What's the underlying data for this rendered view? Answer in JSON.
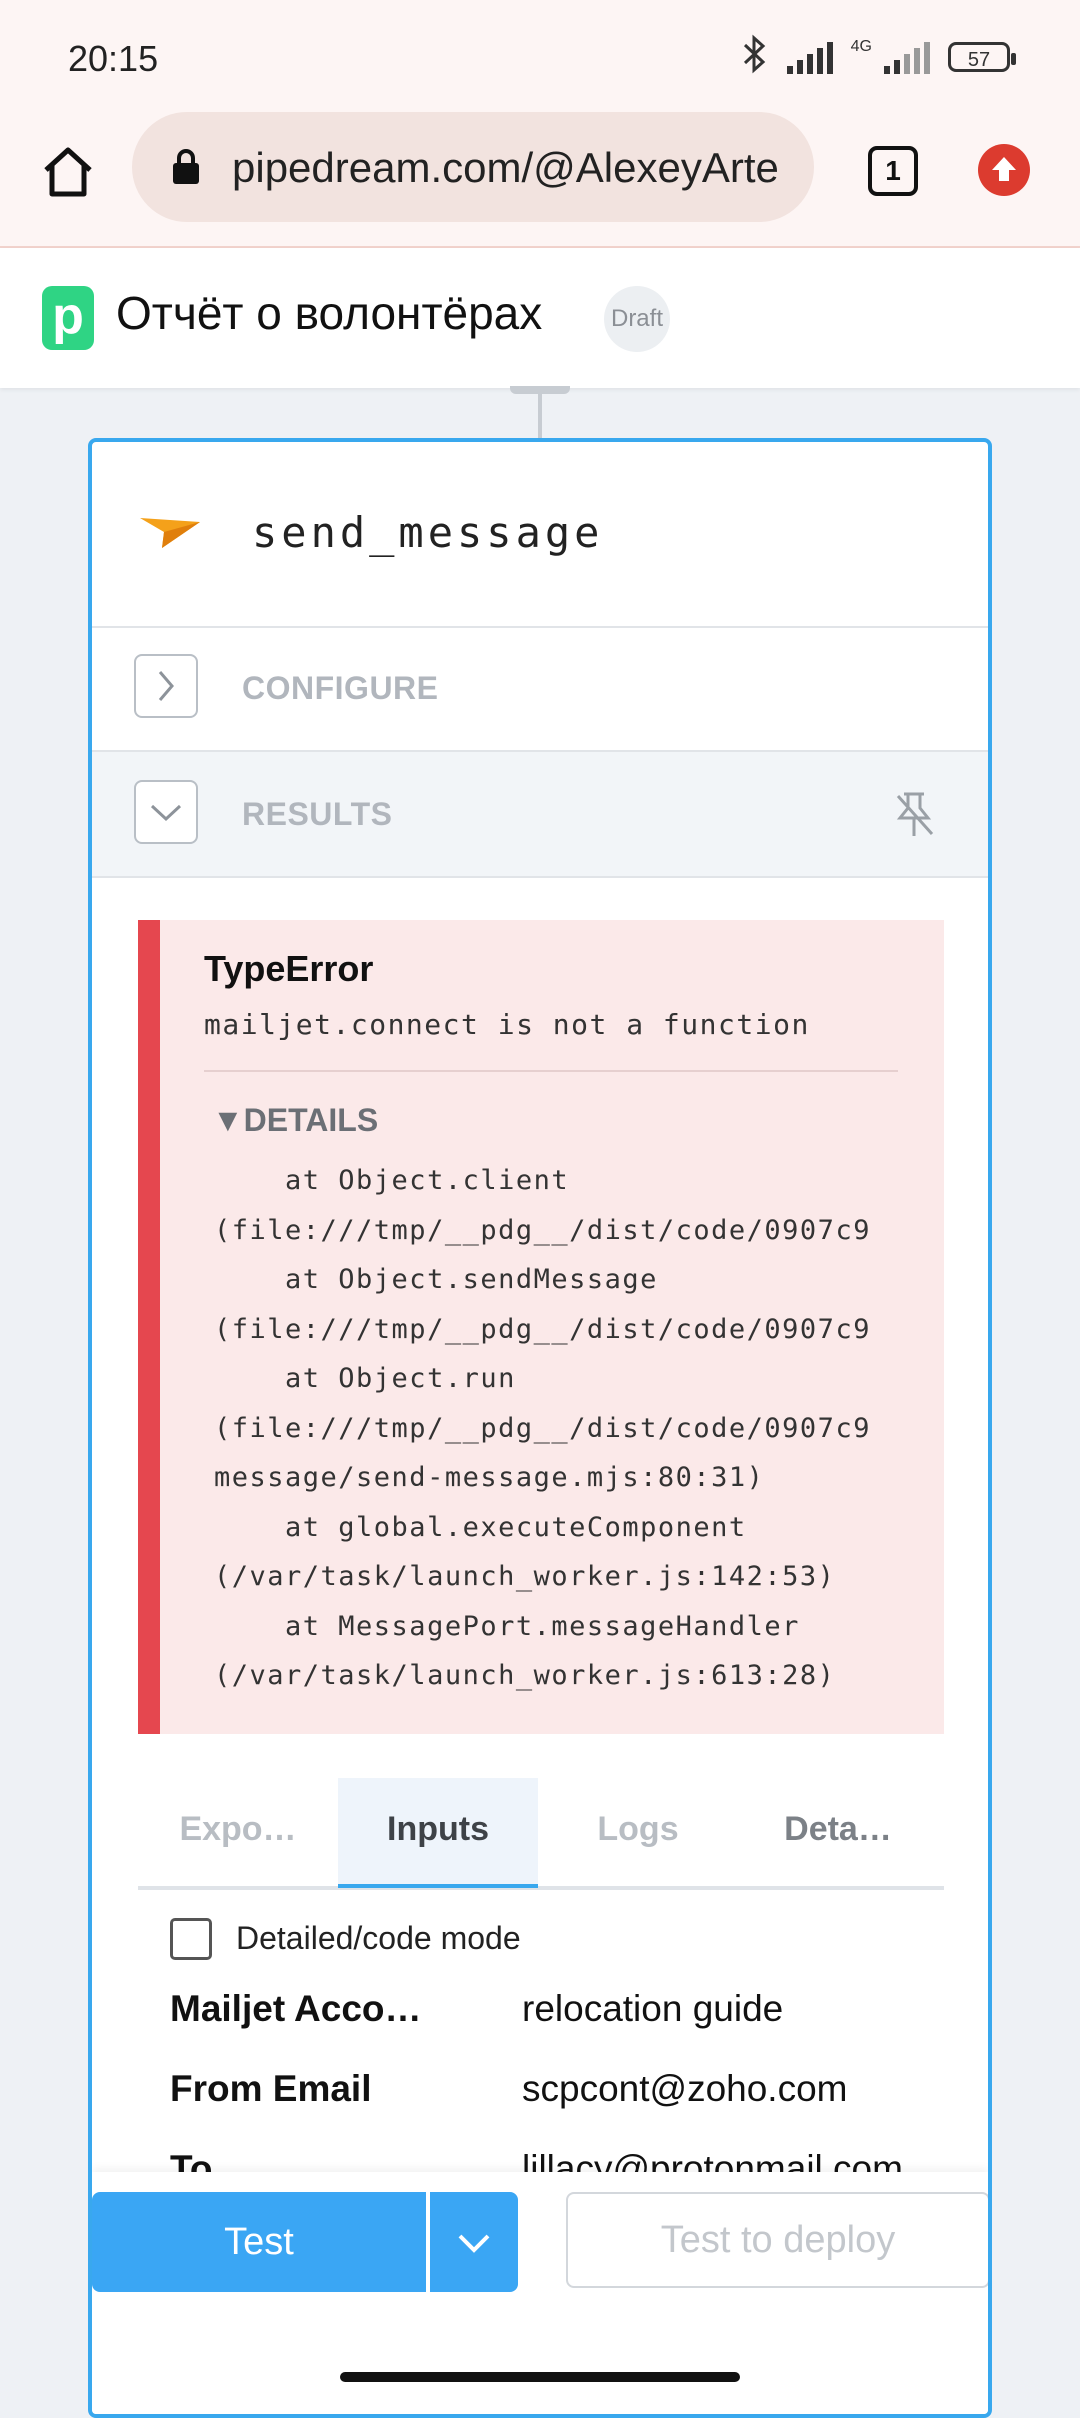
{
  "status_bar": {
    "time": "20:15",
    "network_label": "4G",
    "battery": "57",
    "icons": [
      "bluetooth-icon",
      "signal-icon",
      "signal-icon",
      "battery-icon"
    ]
  },
  "browser": {
    "url": "pipedream.com/@AlexeyArte",
    "tab_count": "1",
    "icons": [
      "home-icon",
      "lock-icon",
      "tabs-icon",
      "update-icon"
    ]
  },
  "workflow": {
    "logo_letter": "p",
    "title": "Отчёт о волонтёрах",
    "badge": "Draft"
  },
  "step": {
    "name": "send_message",
    "configure_label": "CONFIGURE",
    "results_label": "RESULTS"
  },
  "error": {
    "title": "TypeError",
    "message": "mailjet.connect is not a function",
    "details_label": "▼DETAILS",
    "stack_lines": [
      "    at Object.client",
      "(file:///tmp/__pdg__/dist/code/0907c9",
      "    at Object.sendMessage",
      "(file:///tmp/__pdg__/dist/code/0907c9",
      "    at Object.run",
      "(file:///tmp/__pdg__/dist/code/0907c9",
      "message/send-message.mjs:80:31)",
      "    at global.executeComponent",
      "(/var/task/launch_worker.js:142:53)",
      "    at MessagePort.messageHandler",
      "(/var/task/launch_worker.js:613:28)"
    ]
  },
  "tabs": [
    {
      "label": "Expo…"
    },
    {
      "label": "Inputs"
    },
    {
      "label": "Logs"
    },
    {
      "label": "Deta…"
    }
  ],
  "inputs": {
    "mode_label": "Detailed/code mode",
    "rows": [
      {
        "key": "Mailjet Acco…",
        "value": "relocation guide"
      },
      {
        "key": "From Email",
        "value": "scpcont@zoho.com"
      },
      {
        "key": "To",
        "value": "lillacy@protonmail.com"
      }
    ]
  },
  "actions": {
    "test_label": "Test",
    "deploy_label": "Test to deploy"
  }
}
